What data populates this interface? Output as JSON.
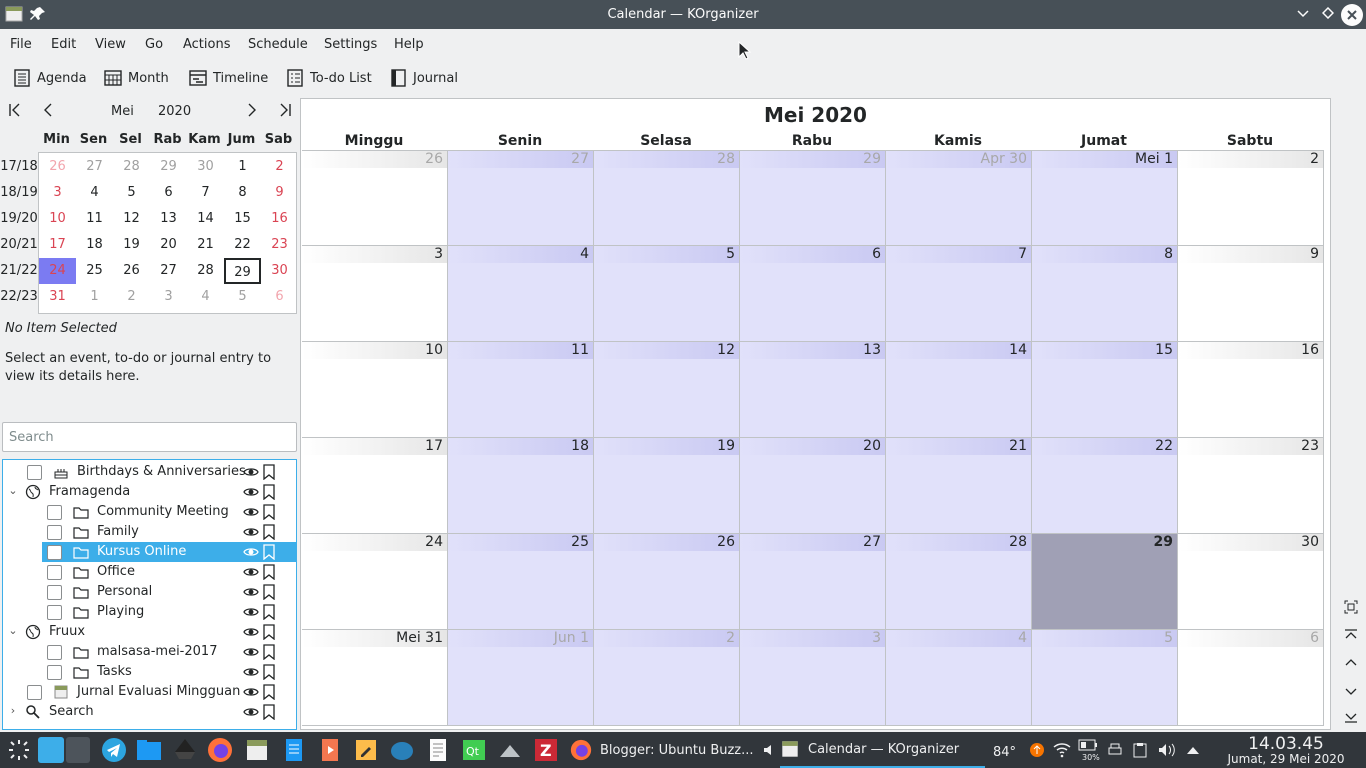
{
  "window": {
    "title": "Calendar — KOrganizer"
  },
  "menu": [
    "File",
    "Edit",
    "View",
    "Go",
    "Actions",
    "Schedule",
    "Settings",
    "Help"
  ],
  "toolbar": [
    {
      "label": "Agenda",
      "icon": "agenda-icon"
    },
    {
      "label": "Month",
      "icon": "month-icon"
    },
    {
      "label": "Timeline",
      "icon": "timeline-icon"
    },
    {
      "label": "To-do List",
      "icon": "todo-list-icon"
    },
    {
      "label": "Journal",
      "icon": "journal-icon"
    }
  ],
  "mini": {
    "month": "Mei",
    "year": "2020",
    "day_names": [
      "Min",
      "Sen",
      "Sel",
      "Rab",
      "Kam",
      "Jum",
      "Sab"
    ],
    "weeks": [
      "17/18",
      "18/19",
      "19/20",
      "20/21",
      "21/22",
      "22/23"
    ],
    "days": [
      [
        "26",
        "27",
        "28",
        "29",
        "30",
        "1",
        "2"
      ],
      [
        "3",
        "4",
        "5",
        "6",
        "7",
        "8",
        "9"
      ],
      [
        "10",
        "11",
        "12",
        "13",
        "14",
        "15",
        "16"
      ],
      [
        "17",
        "18",
        "19",
        "20",
        "21",
        "22",
        "23"
      ],
      [
        "24",
        "25",
        "26",
        "27",
        "28",
        "29",
        "30"
      ],
      [
        "31",
        "1",
        "2",
        "3",
        "4",
        "5",
        "6"
      ]
    ]
  },
  "details": {
    "title": "No Item Selected",
    "text": "Select an event, to-do or journal entry to view its details here."
  },
  "search": {
    "placeholder": "Search"
  },
  "tree": [
    {
      "label": "Birthdays & Anniversaries",
      "level": 1,
      "checkbox": true,
      "icon": "birthday-icon"
    },
    {
      "label": "Framagenda",
      "level": 0,
      "checkbox": false,
      "icon": "globe-icon",
      "expand": true
    },
    {
      "label": "Community Meeting",
      "level": 2,
      "checkbox": true,
      "icon": "folder-icon"
    },
    {
      "label": "Family",
      "level": 2,
      "checkbox": true,
      "icon": "folder-icon"
    },
    {
      "label": "Kursus Online",
      "level": 2,
      "checkbox": true,
      "icon": "folder-icon",
      "selected": true
    },
    {
      "label": "Office",
      "level": 2,
      "checkbox": true,
      "icon": "folder-icon"
    },
    {
      "label": "Personal",
      "level": 2,
      "checkbox": true,
      "icon": "folder-icon"
    },
    {
      "label": "Playing",
      "level": 2,
      "checkbox": true,
      "icon": "folder-icon"
    },
    {
      "label": "Fruux",
      "level": 0,
      "checkbox": false,
      "icon": "globe-icon",
      "expand": true
    },
    {
      "label": "malsasa-mei-2017",
      "level": 2,
      "checkbox": true,
      "icon": "folder-icon"
    },
    {
      "label": "Tasks",
      "level": 2,
      "checkbox": true,
      "icon": "folder-icon"
    },
    {
      "label": "Jurnal Evaluasi Mingguan",
      "level": 1,
      "checkbox": true,
      "icon": "journal-cal-icon"
    },
    {
      "label": "Search",
      "level": 0,
      "checkbox": false,
      "icon": "search-icon",
      "collapsed": true
    }
  ],
  "calendar": {
    "title": "Mei 2020",
    "columns": [
      "Minggu",
      "Senin",
      "Selasa",
      "Rabu",
      "Kamis",
      "Jumat",
      "Sabtu"
    ],
    "weeks": [
      [
        "26",
        "27",
        "28",
        "29",
        "Apr 30",
        "Mei 1",
        "2"
      ],
      [
        "3",
        "4",
        "5",
        "6",
        "7",
        "8",
        "9"
      ],
      [
        "10",
        "11",
        "12",
        "13",
        "14",
        "15",
        "16"
      ],
      [
        "17",
        "18",
        "19",
        "20",
        "21",
        "22",
        "23"
      ],
      [
        "24",
        "25",
        "26",
        "27",
        "28",
        "29",
        "30"
      ],
      [
        "Mei 31",
        "Jun 1",
        "2",
        "3",
        "4",
        "5",
        "6"
      ]
    ]
  },
  "taskbar": {
    "tasks": [
      {
        "label": "Blogger: Ubuntu Buzz...",
        "icon": "firefox-icon"
      },
      {
        "label": "Calendar  — KOrganizer",
        "icon": "korganizer-icon"
      }
    ],
    "weather": "84°",
    "battery": "30%",
    "time": "14.03.45",
    "date": "Jumat, 29 Mei 2020"
  },
  "colors": {
    "accent": "#3daee9",
    "weekday_cell": "#e1e1fa",
    "today_cell": "#a0a0b5",
    "selected_day": "#7b7bf2",
    "sunday_red": "#da4453",
    "titlebar": "#475057",
    "taskbar": "#31363b"
  }
}
